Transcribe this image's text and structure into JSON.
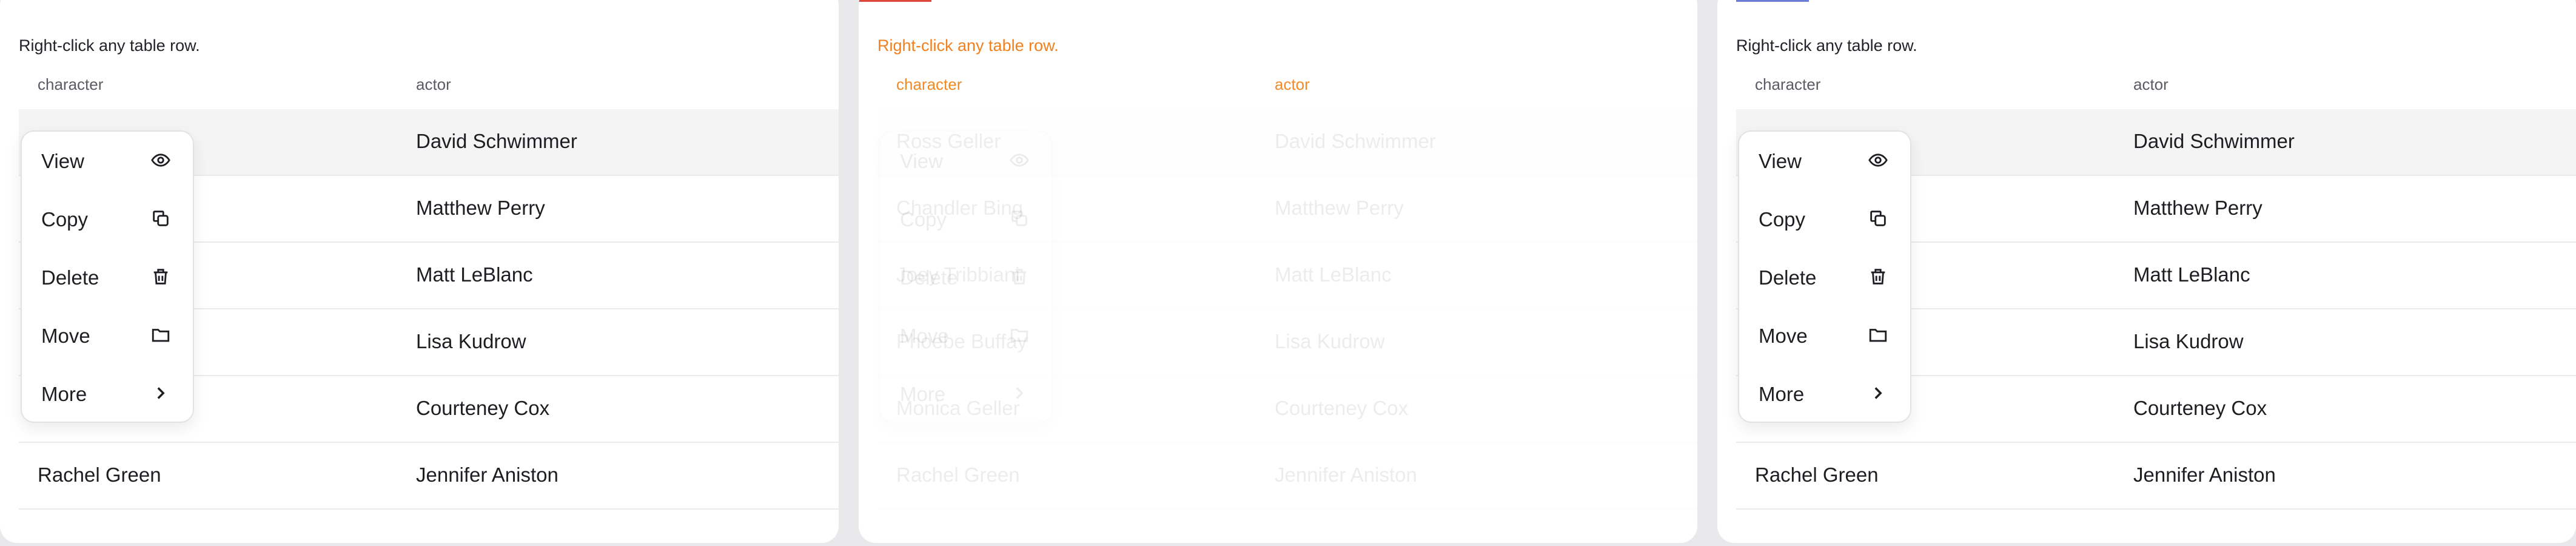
{
  "hint": "Right-click any table row.",
  "columns": {
    "character": "character",
    "actor": "actor"
  },
  "rows": [
    {
      "character": "Ross Geller",
      "actor": "David Schwimmer"
    },
    {
      "character": "Chandler Bing",
      "actor": "Matthew Perry"
    },
    {
      "character": "Joey Tribbiani",
      "actor": "Matt LeBlanc"
    },
    {
      "character": "Phoebe Buffay",
      "actor": "Lisa Kudrow"
    },
    {
      "character": "Monica Geller",
      "actor": "Courteney Cox"
    },
    {
      "character": "Rachel Green",
      "actor": "Jennifer Aniston"
    }
  ],
  "menu": [
    {
      "label": "View",
      "icon": "eye-icon"
    },
    {
      "label": "Copy",
      "icon": "copy-icon"
    },
    {
      "label": "Delete",
      "icon": "trash-icon"
    },
    {
      "label": "Move",
      "icon": "folder-icon"
    },
    {
      "label": "More",
      "icon": "chevron-right-icon"
    }
  ],
  "colors": {
    "accent_red": "#e0453a",
    "accent_blue": "#6b7bd6",
    "hint_orange": "#f07a12"
  }
}
